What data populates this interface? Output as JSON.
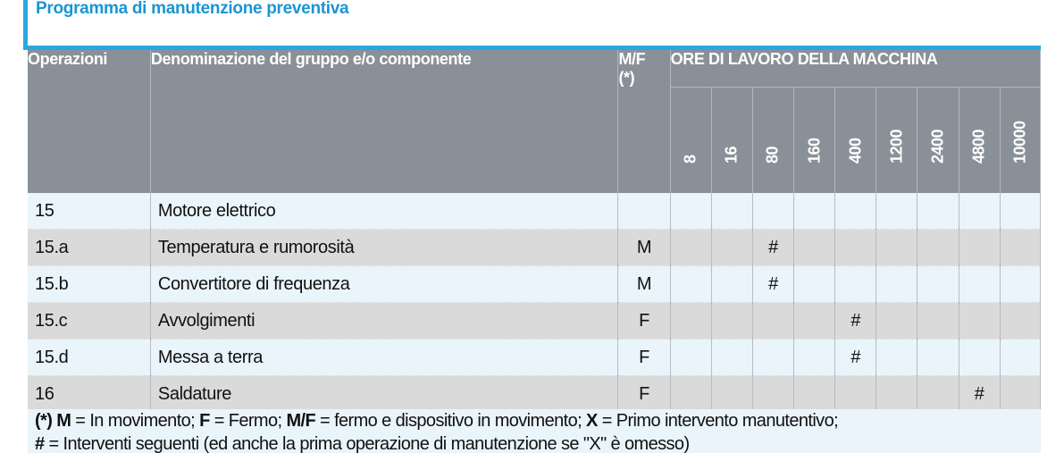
{
  "title": "Programma di manutenzione preventiva",
  "table": {
    "headers": {
      "operations": "Operazioni",
      "component": "Denominazione del gruppo e/o componente",
      "mf_line1": "M/F",
      "mf_line2": "(*)",
      "hours_group": "ORE DI LAVORO DELLA MACCHINA"
    },
    "hours": [
      "8",
      "16",
      "80",
      "160",
      "400",
      "1200",
      "2400",
      "4800",
      "10000"
    ],
    "rows": [
      {
        "op": "15",
        "name": "Motore elettrico",
        "mf": "",
        "marks": [
          "",
          "",
          "",
          "",
          "",
          "",
          "",
          "",
          ""
        ]
      },
      {
        "op": "15.a",
        "name": "Temperatura e rumorosità",
        "mf": "M",
        "marks": [
          "",
          "",
          "#",
          "",
          "",
          "",
          "",
          "",
          ""
        ]
      },
      {
        "op": "15.b",
        "name": "Convertitore di frequenza",
        "mf": "M",
        "marks": [
          "",
          "",
          "#",
          "",
          "",
          "",
          "",
          "",
          ""
        ]
      },
      {
        "op": "15.c",
        "name": "Avvolgimenti",
        "mf": "F",
        "marks": [
          "",
          "",
          "",
          "",
          "#",
          "",
          "",
          "",
          ""
        ]
      },
      {
        "op": "15.d",
        "name": "Messa a terra",
        "mf": "F",
        "marks": [
          "",
          "",
          "",
          "",
          "#",
          "",
          "",
          "",
          ""
        ]
      },
      {
        "op": "16",
        "name": "Saldature",
        "mf": "F",
        "marks": [
          "",
          "",
          "",
          "",
          "",
          "",
          "",
          "#",
          ""
        ]
      }
    ]
  },
  "footnote": {
    "ast": "(*)",
    "m_key": "M",
    "m_text": " = In movimento; ",
    "f_key": "F",
    "f_text": " = Fermo; ",
    "mf_key": "M/F",
    "mf_text": " = fermo e dispositivo in movimento; ",
    "x_key": "X",
    "x_text": " = Primo intervento manutentivo;",
    "hash_key": "#",
    "hash_text": " = Interventi seguenti (ed anche la prima operazione di manutenzione se \"X\" è omesso)"
  }
}
